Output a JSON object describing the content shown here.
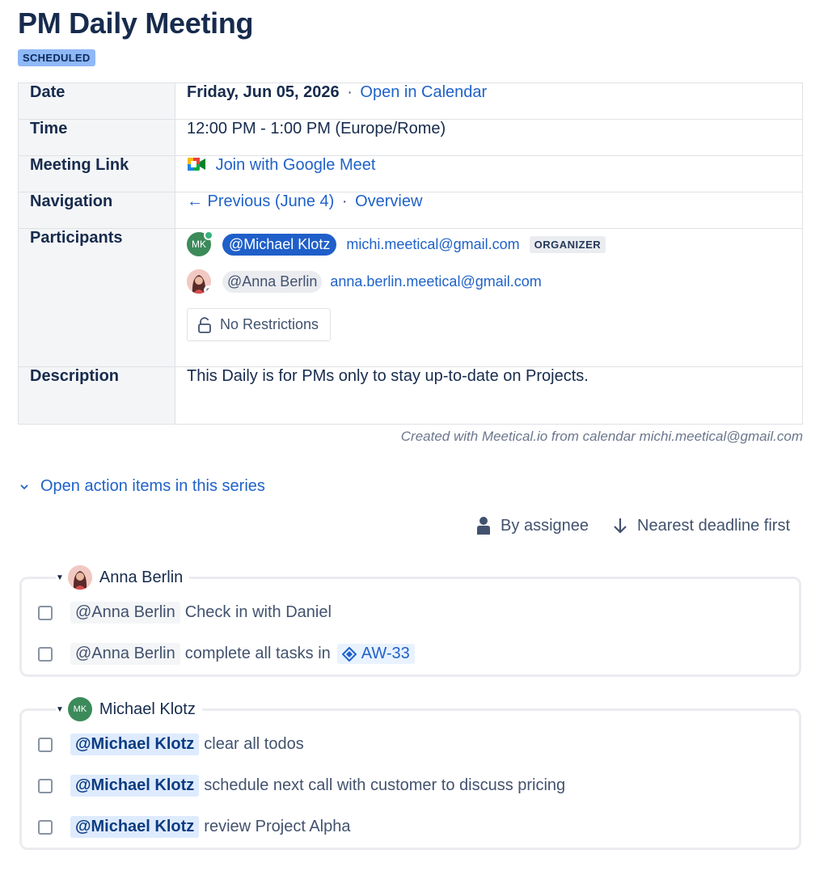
{
  "page": {
    "title": "PM Daily Meeting",
    "status": "SCHEDULED"
  },
  "details": {
    "date_label": "Date",
    "date_value": "Friday, Jun 05, 2026",
    "date_separator": "·",
    "open_calendar": "Open in Calendar",
    "time_label": "Time",
    "time_value": "12:00 PM - 1:00 PM (Europe/Rome)",
    "link_label": "Meeting Link",
    "link_value": "Join with Google Meet",
    "nav_label": "Navigation",
    "nav_previous": "← Previous (June 4)",
    "nav_separator": "·",
    "nav_overview": "Overview",
    "participants_label": "Participants",
    "participants": [
      {
        "initials": "MK",
        "mention": "@Michael Klotz",
        "email": "michi.meetical@gmail.com",
        "badge": "ORGANIZER",
        "avatar_color": "#3c8a5a"
      },
      {
        "initials": "",
        "mention": "@Anna Berlin",
        "email": "anna.berlin.meetical@gmail.com",
        "badge": "",
        "avatar_color": "#f1c9c2"
      }
    ],
    "restrictions_label": "No Restrictions",
    "description_label": "Description",
    "description_value": "This Daily is for PMs only to stay up-to-date on Projects."
  },
  "footer_note": "Created with Meetical.io from calendar michi.meetical@gmail.com",
  "action_items": {
    "toggle_label": "Open action items in this series",
    "sort_by_assignee": "By assignee",
    "sort_deadline": "Nearest deadline first",
    "groups": [
      {
        "assignee": "Anna Berlin",
        "tasks": [
          {
            "mention": "@Anna Berlin",
            "text": "Check in with Daniel",
            "jira": ""
          },
          {
            "mention": "@Anna Berlin",
            "text": "complete all tasks in",
            "jira": "AW-33"
          }
        ]
      },
      {
        "assignee": "Michael Klotz",
        "initials": "MK",
        "tasks": [
          {
            "mention": "@Michael Klotz",
            "text": "clear all todos"
          },
          {
            "mention": "@Michael Klotz",
            "text": "schedule next call with customer to discuss pricing"
          },
          {
            "mention": "@Michael Klotz",
            "text": "review Project Alpha"
          }
        ]
      }
    ]
  },
  "colors": {
    "link": "#1f62c9",
    "status_badge": "#8fb8f6",
    "primary_mention": "#1f5fc9",
    "organizer_avatar": "#3c8a5a"
  },
  "icons": {
    "meet": "google-meet-icon",
    "lock": "unlock-icon",
    "chevron": "chevron-down-icon",
    "person": "person-icon",
    "arrow": "arrow-down-icon",
    "jira": "jira-icon"
  }
}
